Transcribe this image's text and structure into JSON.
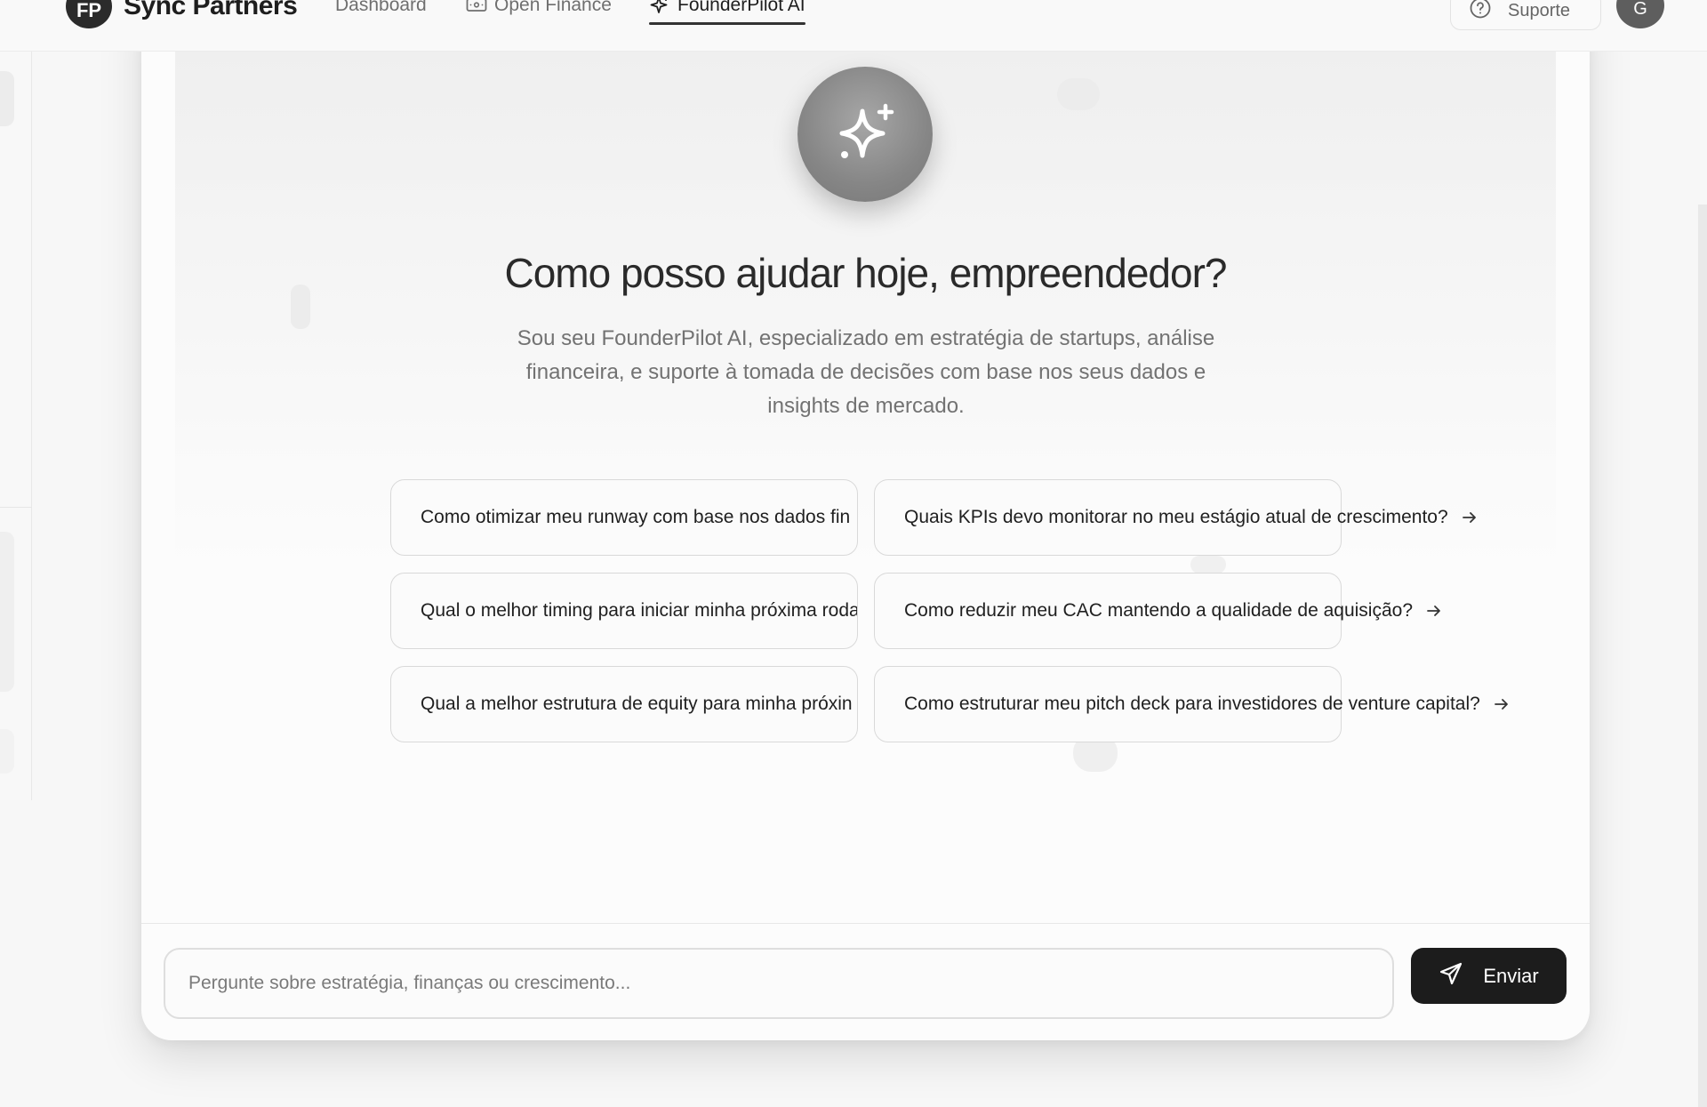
{
  "header": {
    "logo_initials": "FP",
    "brand": "Sync Partners",
    "nav": [
      {
        "label": "Dashboard",
        "icon": ""
      },
      {
        "label": "Open Finance",
        "icon": "wallet-icon"
      },
      {
        "label": "FounderPilot AI",
        "icon": "sparkle-icon",
        "active": true
      }
    ],
    "support_label": "Suporte",
    "avatar_initial": "G"
  },
  "hero": {
    "icon": "sparkles-icon",
    "title": "Como posso ajudar hoje, empreendedor?",
    "description": "Sou seu FounderPilot AI, especializado em estratégia de startups, análise financeira, e suporte à tomada de decisões com base nos seus dados e insights de mercado."
  },
  "suggestions": [
    "Como otimizar meu runway com base nos dados fin",
    "Quais KPIs devo monitorar no meu estágio atual de crescimento?",
    "Qual o melhor timing para iniciar minha próxima roda",
    "Como reduzir meu CAC mantendo a qualidade de aquisição?",
    "Qual a melhor estrutura de equity para minha próxin",
    "Como estruturar meu pitch deck para investidores de venture capital?"
  ],
  "chat": {
    "placeholder": "Pergunte sobre estratégia, finanças ou crescimento...",
    "send_label": "Enviar"
  },
  "colors": {
    "accent": "#1c1c1c",
    "background": "#f7f7f7",
    "card": "#fcfcfc"
  }
}
